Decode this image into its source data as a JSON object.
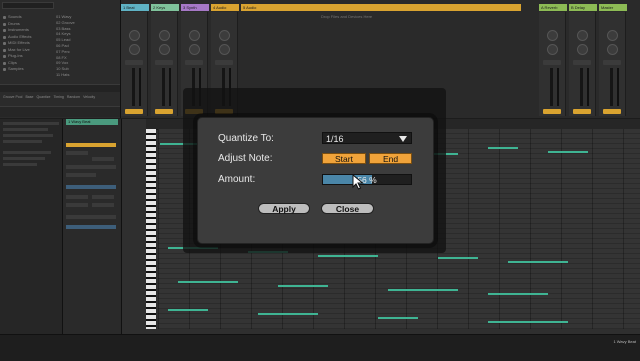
{
  "dialog": {
    "quantize_label": "Quantize To:",
    "quantize_value": "1/16",
    "adjust_label": "Adjust Note:",
    "start_label": "Start",
    "end_label": "End",
    "amount_label": "Amount:",
    "amount_value": "56 %",
    "amount_fraction": 0.56,
    "apply_label": "Apply",
    "close_label": "Close"
  },
  "browser": {
    "categories": [
      "Sounds",
      "Drums",
      "Instruments",
      "Audio Effects",
      "MIDI Effects",
      "Max for Live",
      "Plug-Ins",
      "Clips",
      "Samples"
    ],
    "files": [
      "01 Wavy",
      "02 Groove",
      "03 Bass",
      "04 Keys",
      "05 Lead",
      "06 Pad",
      "07 Perc",
      "08 FX",
      "09 Vox",
      "10 Sub",
      "11 Hats"
    ],
    "bottom_items": [
      "Groove Pool",
      "Base",
      "Quantize",
      "Timing",
      "Random",
      "Velocity"
    ]
  },
  "session": {
    "tracks": [
      {
        "name": "1 Beat",
        "color": "#5fb2c4"
      },
      {
        "name": "2 Keys",
        "color": "#7fc29b"
      },
      {
        "name": "3 Synth",
        "color": "#a678c6"
      },
      {
        "name": "4 Audio",
        "color": "#d9a330"
      },
      {
        "name": "5 Audio",
        "color": "#d9a330"
      },
      {
        "name": "A Reverb",
        "color": "#8dbb55"
      },
      {
        "name": "B Delay",
        "color": "#8dbb55"
      },
      {
        "name": "Master",
        "color": "#8dbb55"
      }
    ],
    "drop_hint": "Drop Files and Devices Here"
  },
  "clip": {
    "name": "1 Wavy Beat",
    "bottom_label": "1 Wavy Beat"
  },
  "colors": {
    "accent_orange": "#f0a33a",
    "amount_fill": "#4a86a8",
    "note_green": "#3fb493"
  }
}
